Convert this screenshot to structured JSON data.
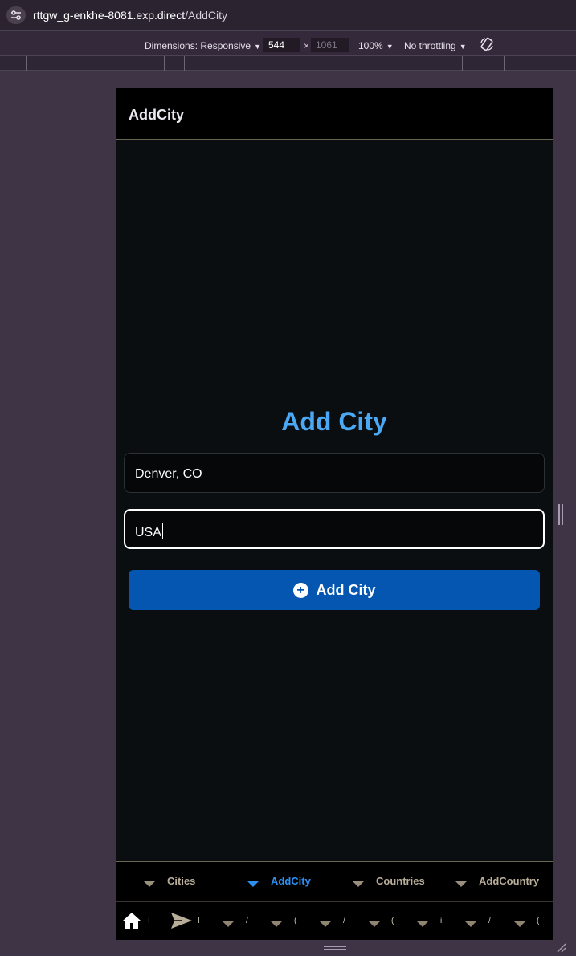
{
  "browser": {
    "url_host": "rttgw_g-enkhe-8081.exp.direct",
    "url_path": "/AddCity"
  },
  "devtools": {
    "dimensions_label": "Dimensions: Responsive",
    "width": "544",
    "height": "1061",
    "times": "×",
    "zoom": "100%",
    "throttling": "No throttling"
  },
  "app": {
    "header_title": "AddCity",
    "heading": "Add City",
    "city_field_value": "Denver, CO",
    "country_field_value": "USA",
    "submit_label": "Add City",
    "submit_icon": "plus-circle-icon",
    "accent_color": "#4aa8f5",
    "button_color": "#0456b0"
  },
  "tabs": [
    {
      "label": "Cities",
      "active": false
    },
    {
      "label": "AddCity",
      "active": true
    },
    {
      "label": "Countries",
      "active": false
    },
    {
      "label": "AddCountry",
      "active": false
    }
  ],
  "bottom_nav": {
    "glyphs": [
      "I",
      "/",
      "(",
      "/",
      "(",
      "i",
      "/",
      "("
    ]
  }
}
